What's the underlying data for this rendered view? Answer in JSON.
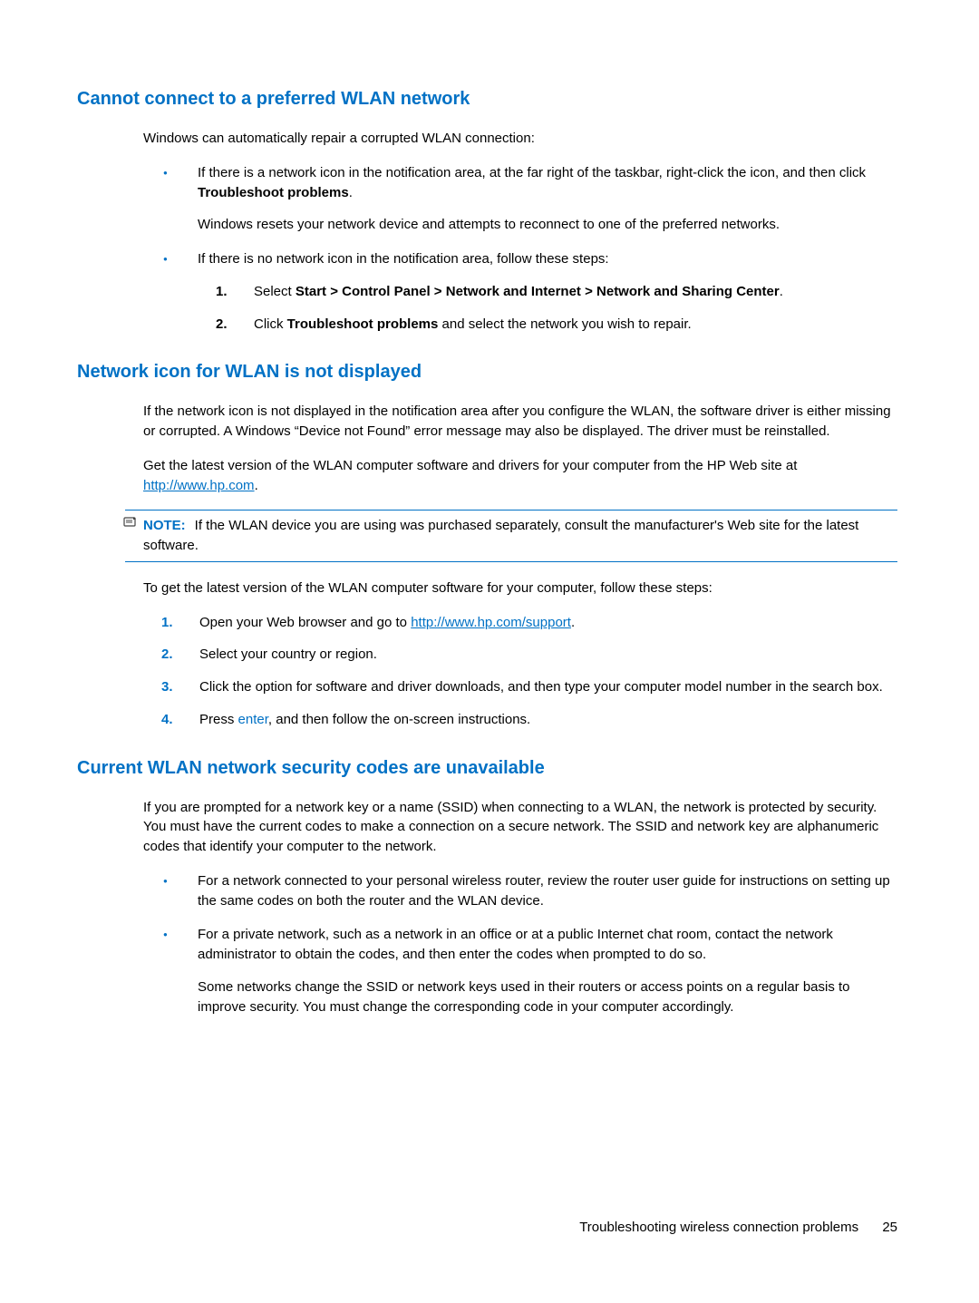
{
  "section1": {
    "heading": "Cannot connect to a preferred WLAN network",
    "intro": "Windows can automatically repair a corrupted WLAN connection:",
    "bullet1_pre": "If there is a network icon in the notification area, at the far right of the taskbar, right-click the icon, and then click ",
    "bullet1_bold": "Troubleshoot problems",
    "bullet1_post": ".",
    "bullet1_sub": "Windows resets your network device and attempts to reconnect to one of the preferred networks.",
    "bullet2": "If there is no network icon in the notification area, follow these steps:",
    "step1_pre": "Select ",
    "step1_bold": "Start > Control Panel > Network and Internet > Network and Sharing Center",
    "step1_post": ".",
    "step2_pre": "Click ",
    "step2_bold": "Troubleshoot problems",
    "step2_post": " and select the network you wish to repair."
  },
  "section2": {
    "heading": "Network icon for WLAN is not displayed",
    "para1": "If the network icon is not displayed in the notification area after you configure the WLAN, the software driver is either missing or corrupted. A Windows “Device not Found” error message may also be displayed. The driver must be reinstalled.",
    "para2_pre": "Get the latest version of the WLAN computer software and drivers for your computer from the HP Web site at ",
    "para2_link": "http://www.hp.com",
    "para2_post": ".",
    "note_label": "NOTE:",
    "note_text": "If the WLAN device you are using was purchased separately, consult the manufacturer's Web site for the latest software.",
    "para3": "To get the latest version of the WLAN computer software for your computer, follow these steps:",
    "step1_pre": "Open your Web browser and go to ",
    "step1_link": "http://www.hp.com/support",
    "step1_post": ".",
    "step2": "Select your country or region.",
    "step3": "Click the option for software and driver downloads, and then type your computer model number in the search box.",
    "step4_pre": "Press ",
    "step4_key": "enter",
    "step4_post": ", and then follow the on-screen instructions."
  },
  "section3": {
    "heading": "Current WLAN network security codes are unavailable",
    "para1": "If you are prompted for a network key or a name (SSID) when connecting to a WLAN, the network is protected by security. You must have the current codes to make a connection on a secure network. The SSID and network key are alphanumeric codes that identify your computer to the network.",
    "bullet1": "For a network connected to your personal wireless router, review the router user guide for instructions on setting up the same codes on both the router and the WLAN device.",
    "bullet2": "For a private network, such as a network in an office or at a public Internet chat room, contact the network administrator to obtain the codes, and then enter the codes when prompted to do so.",
    "bullet2_sub": "Some networks change the SSID or network keys used in their routers or access points on a regular basis to improve security. You must change the corresponding code in your computer accordingly."
  },
  "footer": {
    "text": "Troubleshooting wireless connection problems",
    "page": "25"
  }
}
